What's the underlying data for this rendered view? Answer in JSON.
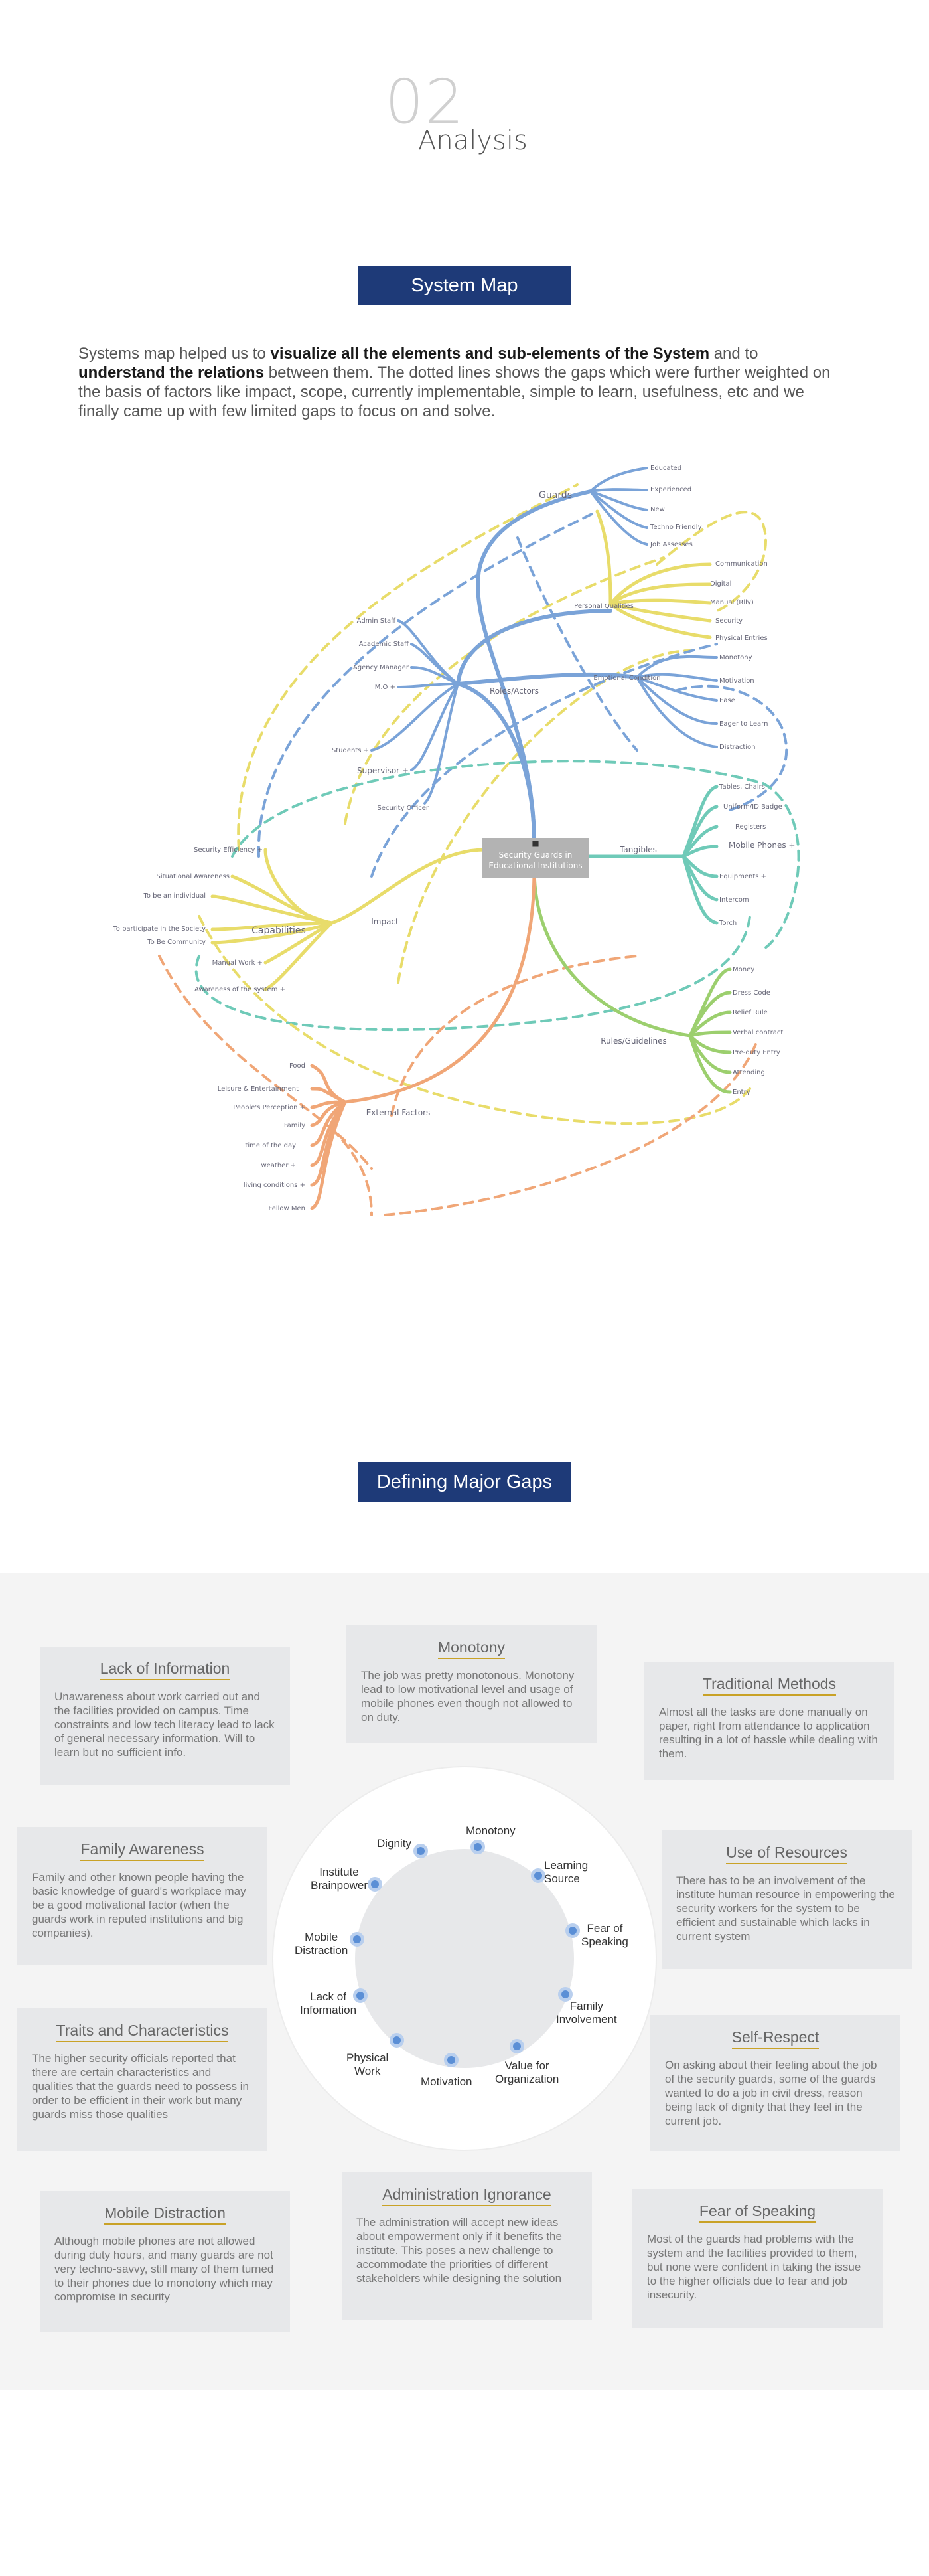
{
  "header": {
    "number": "02",
    "title": "Analysis"
  },
  "system_map": {
    "title": "System Map",
    "intro": {
      "p1": "Systems map helped us to ",
      "b1": "visualize all the elements and sub-elements of the System",
      "p2": " and to ",
      "b2": "understand the relations",
      "p3": " between them. The dotted lines shows the gaps which were further weighted on the basis of factors like impact, scope, currently implementable, simple to learn, usefulness, etc and we finally came up with few limited gaps to focus on and solve."
    },
    "center": {
      "line1": "Security Guards in",
      "line2": "Educational Institutions"
    },
    "colors": {
      "blue": "#7aa3d8",
      "yellow": "#e8dc6a",
      "green": "#9ccf6e",
      "teal": "#6fcab8",
      "orange": "#f0a677",
      "center_box": "#b3b3b3"
    },
    "nodes": {
      "guards": "Guards",
      "guards_leaves": [
        "Educated",
        "Experienced",
        "New",
        "Techno Friendly",
        "Job Assesses"
      ],
      "roles_actors": "Roles/Actors",
      "actors_leaves": [
        "Admin Staff",
        "Academic Staff",
        "Agency Manager",
        "M.O +",
        "Students +",
        "Supervisor +",
        "Security Officer"
      ],
      "communication": [
        "Communication",
        "Digital",
        "Manual (Rlly)",
        "Security",
        "Physical Entries"
      ],
      "personal_qualities": "Personal Qualities",
      "guard_attrs": [
        "Monotony",
        "Motivation",
        "Ease",
        "Eager to Learn",
        "Distraction"
      ],
      "emotional_condition": "Emotional Condition",
      "tangibles": "Tangibles",
      "tangible_leaves": [
        "Tables, Chairs",
        "Uniform/ID Badge",
        "Registers",
        "Mobile Phones +",
        "Equipments +",
        "Intercom",
        "Torch"
      ],
      "capabilities": "Capabilities",
      "capability_leaves": [
        "Security Efficiency +",
        "Situational Awareness",
        "To be an individual",
        "To participate in the Society",
        "To Be Community",
        "Manual Work +",
        "Awareness of the system +"
      ],
      "impact": "Impact",
      "rules_guidelines": "Rules/Guidelines",
      "rules_leaves": [
        "Money",
        "Dress Code",
        "Relief Rule",
        "Verbal contract",
        "Pre-duty Entry",
        "Attending",
        "Entry"
      ],
      "external_factors": "External Factors",
      "external_leaves": [
        "Food",
        "Leisure & Entertainment",
        "People's Perception +",
        "Family",
        "time of the day",
        "weather +",
        "living conditions +",
        "Fellow Men"
      ]
    }
  },
  "gaps": {
    "title": "Defining Major Gaps",
    "cards": {
      "lack_of_information": {
        "title": "Lack of Information",
        "text": "Unawareness about work carried out and the facilities provided on campus. Time constraints and low tech literacy lead to lack of general necessary information. Will to learn but no sufficient info."
      },
      "monotony": {
        "title": "Monotony",
        "text": "The job was pretty monotonous. Monotony lead to low motivational level and usage of mobile phones even though not allowed to on duty."
      },
      "traditional_methods": {
        "title": "Traditional Methods",
        "text": "Almost all the tasks are done manually on paper, right from attendance to application resulting in a lot of hassle while dealing with them."
      },
      "family_awareness": {
        "title": "Family Awareness",
        "text": "Family and other known people having the basic knowledge of guard's workplace may be a good motivational factor (when the guards work in reputed institutions and big companies)."
      },
      "use_of_resources": {
        "title": "Use of Resources",
        "text": "There has to be an involvement of the institute human resource in empowering the security workers for the system to be efficient and sustainable which lacks in current system"
      },
      "traits": {
        "title": "Traits and Characteristics",
        "text": "The higher security officials reported that there are certain characteristics and qualities that the guards need to possess in order to be efficient in their work but many guards miss those qualities"
      },
      "self_respect": {
        "title": "Self-Respect",
        "text": "On asking about their feeling about the job of the security guards, some of the guards wanted to do a job in civil dress, reason being lack of dignity that they feel in the current job."
      },
      "mobile_distraction": {
        "title": "Mobile Distraction",
        "text": "Although mobile phones are not allowed during duty hours, and many guards are not very techno-savvy, still many of them turned to their phones due to monotony which may compromise in security"
      },
      "admin_ignorance": {
        "title": "Administration Ignorance",
        "text": "The administration will accept new ideas about empowerment only if it benefits the institute. This poses a new challenge to accommodate the priorities of different stakeholders while designing the solution"
      },
      "fear_of_speaking": {
        "title": "Fear of Speaking",
        "text": "Most of the guards had problems with the system and the facilities provided to them, but none were confident in taking the issue to the higher officials due to fear and job insecurity."
      }
    },
    "wheel": {
      "dignity": "Dignity",
      "monotony": "Monotony",
      "learning_source": "Learning\nSource",
      "institute_brainpower": "Institute\nBrainpower",
      "fear_of_speaking": "Fear of\nSpeaking",
      "mobile_distraction": "Mobile\nDistraction",
      "family_involvement": "Family\nInvolvement",
      "lack_of_information": "Lack of\nInformation",
      "physical_work": "Physical\nWork",
      "motivation": "Motivation",
      "value_for_organization": "Value for\nOrganization"
    }
  }
}
